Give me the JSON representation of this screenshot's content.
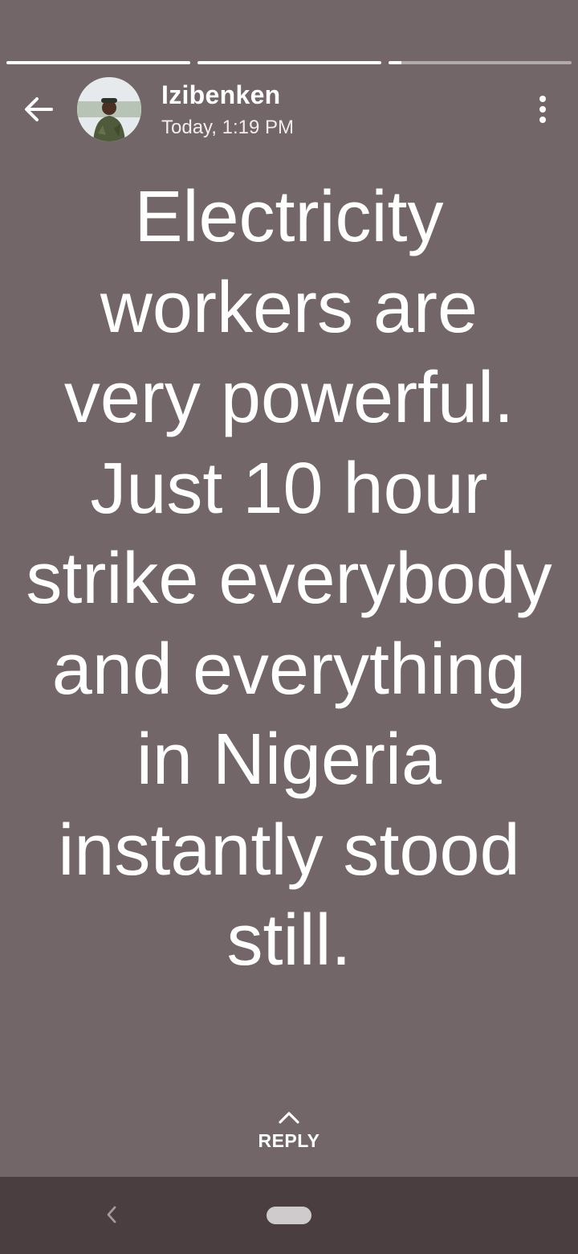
{
  "story": {
    "segments": [
      {
        "progress": 1.0
      },
      {
        "progress": 1.0
      },
      {
        "progress": 0.07
      }
    ],
    "username": "Izibenken",
    "timestamp": "Today, 1:19 PM",
    "text": "Electricity workers are very powerful. Just 10 hour strike everybody and everything in Nigeria instantly stood still.",
    "background_color": "#736669",
    "reply_label": "REPLY"
  },
  "icons": {
    "back": "arrow-left-icon",
    "menu": "more-vertical-icon",
    "reply": "chevron-up-icon",
    "nav_back": "nav-back-chevron-icon",
    "nav_home": "home-pill-icon"
  },
  "nav": {
    "background_color": "#4a3e41"
  }
}
